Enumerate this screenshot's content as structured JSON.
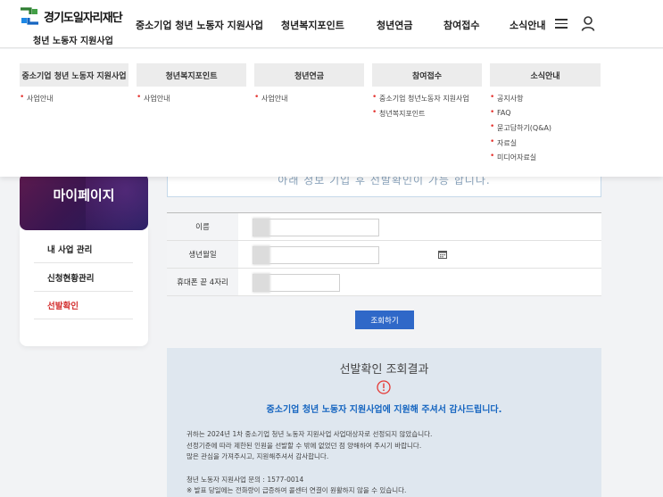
{
  "header": {
    "logo_name": "경기도일자리재단",
    "logo_sub": "청년 노동자 지원사업",
    "nav": [
      "중소기업 청년 노동자 지원사업",
      "청년복지포인트",
      "청년연금",
      "참여접수",
      "소식안내"
    ]
  },
  "mega_menu": {
    "columns": [
      {
        "title": "중소기업 청년 노동자 지원사업",
        "items": [
          "사업안내"
        ]
      },
      {
        "title": "청년복지포인트",
        "items": [
          "사업안내"
        ]
      },
      {
        "title": "청년연금",
        "items": [
          "사업안내"
        ]
      },
      {
        "title": "참여접수",
        "items": [
          "중소기업 청년노동자 지원사업",
          "청년복지포인트"
        ]
      },
      {
        "title": "소식안내",
        "items": [
          "공지사항",
          "FAQ",
          "묻고답하기(Q&A)",
          "자료실",
          "미디어자료실"
        ]
      }
    ]
  },
  "notice_box": "아래 정보 기입 후 선발확인이 가능 합니다.",
  "sidebar": {
    "title": "마이페이지",
    "items": [
      "내 사업 관리",
      "신청현황관리",
      "선발확인"
    ]
  },
  "form": {
    "name_label": "이름",
    "name_value": "",
    "birth_label": "생년월일",
    "birth_value": "",
    "phone_label": "휴대폰 끝 4자리",
    "phone_value": "",
    "search_button": "조회하기"
  },
  "result": {
    "title": "선발확인 조회결과",
    "message": "중소기업 청년 노동자 지원사업에 지원해 주셔서 감사드립니다.",
    "body_lines": [
      "귀하는 2024년 1차 중소기업 청년 노동자 지원사업 사업대상자로 선정되지 않았습니다.",
      "선정기준에 따라 제한된 인원을 선발할 수 밖에 없었던 점 양해하여 주시기 바랍니다.",
      "많은 관심을 가져주시고, 지원해주셔서 감사합니다."
    ],
    "contact_lines": [
      "청년 노동자 지원사업 문의 : 1577-0014",
      "※ 발표 당일에는 전화량이 급증하여 콜센터 연결이 원활하지 않을 수 있습니다."
    ]
  },
  "colors": {
    "accent_blue": "#2f68c8",
    "active_red": "#d32f2f",
    "bullet_red": "#e53935"
  }
}
